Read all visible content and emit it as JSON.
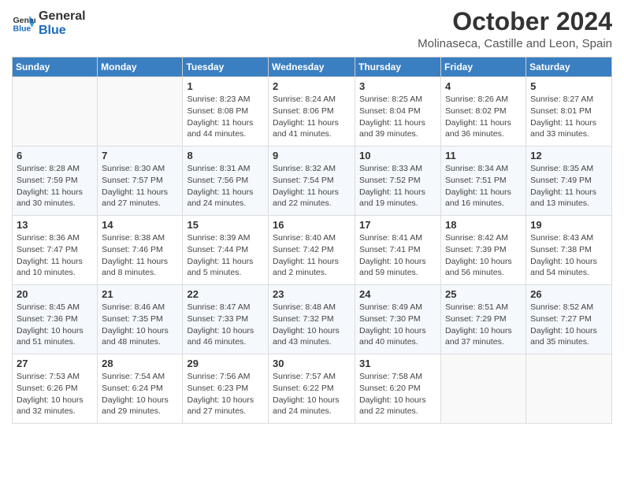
{
  "header": {
    "logo_general": "General",
    "logo_blue": "Blue",
    "month": "October 2024",
    "location": "Molinaseca, Castille and Leon, Spain"
  },
  "weekdays": [
    "Sunday",
    "Monday",
    "Tuesday",
    "Wednesday",
    "Thursday",
    "Friday",
    "Saturday"
  ],
  "weeks": [
    [
      {
        "day": "",
        "detail": ""
      },
      {
        "day": "",
        "detail": ""
      },
      {
        "day": "1",
        "detail": "Sunrise: 8:23 AM\nSunset: 8:08 PM\nDaylight: 11 hours and 44 minutes."
      },
      {
        "day": "2",
        "detail": "Sunrise: 8:24 AM\nSunset: 8:06 PM\nDaylight: 11 hours and 41 minutes."
      },
      {
        "day": "3",
        "detail": "Sunrise: 8:25 AM\nSunset: 8:04 PM\nDaylight: 11 hours and 39 minutes."
      },
      {
        "day": "4",
        "detail": "Sunrise: 8:26 AM\nSunset: 8:02 PM\nDaylight: 11 hours and 36 minutes."
      },
      {
        "day": "5",
        "detail": "Sunrise: 8:27 AM\nSunset: 8:01 PM\nDaylight: 11 hours and 33 minutes."
      }
    ],
    [
      {
        "day": "6",
        "detail": "Sunrise: 8:28 AM\nSunset: 7:59 PM\nDaylight: 11 hours and 30 minutes."
      },
      {
        "day": "7",
        "detail": "Sunrise: 8:30 AM\nSunset: 7:57 PM\nDaylight: 11 hours and 27 minutes."
      },
      {
        "day": "8",
        "detail": "Sunrise: 8:31 AM\nSunset: 7:56 PM\nDaylight: 11 hours and 24 minutes."
      },
      {
        "day": "9",
        "detail": "Sunrise: 8:32 AM\nSunset: 7:54 PM\nDaylight: 11 hours and 22 minutes."
      },
      {
        "day": "10",
        "detail": "Sunrise: 8:33 AM\nSunset: 7:52 PM\nDaylight: 11 hours and 19 minutes."
      },
      {
        "day": "11",
        "detail": "Sunrise: 8:34 AM\nSunset: 7:51 PM\nDaylight: 11 hours and 16 minutes."
      },
      {
        "day": "12",
        "detail": "Sunrise: 8:35 AM\nSunset: 7:49 PM\nDaylight: 11 hours and 13 minutes."
      }
    ],
    [
      {
        "day": "13",
        "detail": "Sunrise: 8:36 AM\nSunset: 7:47 PM\nDaylight: 11 hours and 10 minutes."
      },
      {
        "day": "14",
        "detail": "Sunrise: 8:38 AM\nSunset: 7:46 PM\nDaylight: 11 hours and 8 minutes."
      },
      {
        "day": "15",
        "detail": "Sunrise: 8:39 AM\nSunset: 7:44 PM\nDaylight: 11 hours and 5 minutes."
      },
      {
        "day": "16",
        "detail": "Sunrise: 8:40 AM\nSunset: 7:42 PM\nDaylight: 11 hours and 2 minutes."
      },
      {
        "day": "17",
        "detail": "Sunrise: 8:41 AM\nSunset: 7:41 PM\nDaylight: 10 hours and 59 minutes."
      },
      {
        "day": "18",
        "detail": "Sunrise: 8:42 AM\nSunset: 7:39 PM\nDaylight: 10 hours and 56 minutes."
      },
      {
        "day": "19",
        "detail": "Sunrise: 8:43 AM\nSunset: 7:38 PM\nDaylight: 10 hours and 54 minutes."
      }
    ],
    [
      {
        "day": "20",
        "detail": "Sunrise: 8:45 AM\nSunset: 7:36 PM\nDaylight: 10 hours and 51 minutes."
      },
      {
        "day": "21",
        "detail": "Sunrise: 8:46 AM\nSunset: 7:35 PM\nDaylight: 10 hours and 48 minutes."
      },
      {
        "day": "22",
        "detail": "Sunrise: 8:47 AM\nSunset: 7:33 PM\nDaylight: 10 hours and 46 minutes."
      },
      {
        "day": "23",
        "detail": "Sunrise: 8:48 AM\nSunset: 7:32 PM\nDaylight: 10 hours and 43 minutes."
      },
      {
        "day": "24",
        "detail": "Sunrise: 8:49 AM\nSunset: 7:30 PM\nDaylight: 10 hours and 40 minutes."
      },
      {
        "day": "25",
        "detail": "Sunrise: 8:51 AM\nSunset: 7:29 PM\nDaylight: 10 hours and 37 minutes."
      },
      {
        "day": "26",
        "detail": "Sunrise: 8:52 AM\nSunset: 7:27 PM\nDaylight: 10 hours and 35 minutes."
      }
    ],
    [
      {
        "day": "27",
        "detail": "Sunrise: 7:53 AM\nSunset: 6:26 PM\nDaylight: 10 hours and 32 minutes."
      },
      {
        "day": "28",
        "detail": "Sunrise: 7:54 AM\nSunset: 6:24 PM\nDaylight: 10 hours and 29 minutes."
      },
      {
        "day": "29",
        "detail": "Sunrise: 7:56 AM\nSunset: 6:23 PM\nDaylight: 10 hours and 27 minutes."
      },
      {
        "day": "30",
        "detail": "Sunrise: 7:57 AM\nSunset: 6:22 PM\nDaylight: 10 hours and 24 minutes."
      },
      {
        "day": "31",
        "detail": "Sunrise: 7:58 AM\nSunset: 6:20 PM\nDaylight: 10 hours and 22 minutes."
      },
      {
        "day": "",
        "detail": ""
      },
      {
        "day": "",
        "detail": ""
      }
    ]
  ]
}
